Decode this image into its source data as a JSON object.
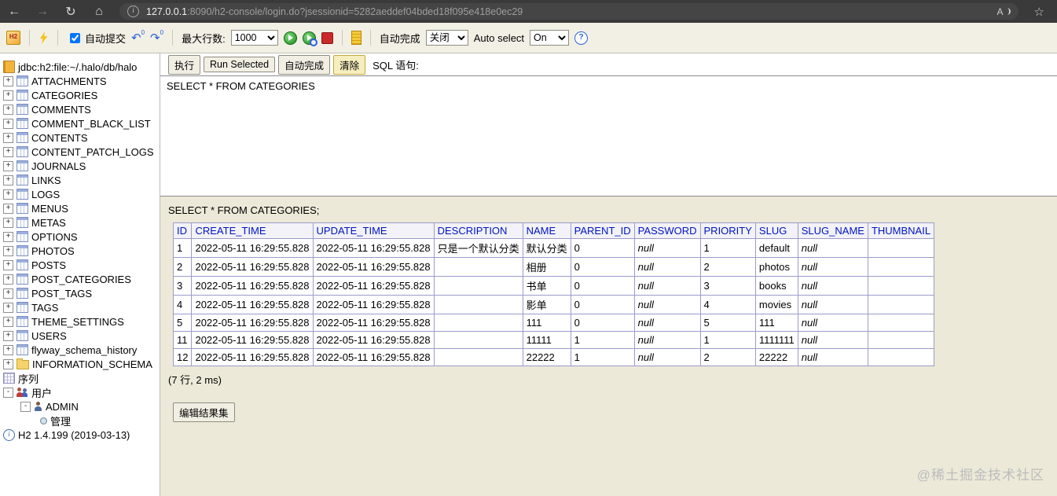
{
  "browser": {
    "url_host": "127.0.0.1",
    "url_rest": ":8090/h2-console/login.do?jsessionid=5282aeddef04bded18f095e418e0ec29"
  },
  "icons": {
    "back": "←",
    "forward": "→",
    "refresh": "↻",
    "home": "⌂",
    "info": "i",
    "read_aloud": "A",
    "favorites_star": "☆",
    "undo": "↶",
    "redo": "↷",
    "help": "?",
    "h2_logo": "H2",
    "expand_plus": "+",
    "expand_minus": "-"
  },
  "toolbar": {
    "autocommit_label": "自动提交",
    "undo_count": "0",
    "redo_count": "0",
    "max_rows_label": "最大行数:",
    "max_rows_value": "1000",
    "autocomplete_label": "自动完成",
    "autocomplete_value": "关闭",
    "autoselect_label": "Auto select",
    "autoselect_value": "On"
  },
  "sidebar": {
    "root": "jdbc:h2:file:~/.halo/db/halo",
    "tables": [
      "ATTACHMENTS",
      "CATEGORIES",
      "COMMENTS",
      "COMMENT_BLACK_LIST",
      "CONTENTS",
      "CONTENT_PATCH_LOGS",
      "JOURNALS",
      "LINKS",
      "LOGS",
      "MENUS",
      "METAS",
      "OPTIONS",
      "PHOTOS",
      "POSTS",
      "POST_CATEGORIES",
      "POST_TAGS",
      "TAGS",
      "THEME_SETTINGS",
      "USERS",
      "flyway_schema_history"
    ],
    "info_schema": "INFORMATION_SCHEMA",
    "sequences": "序列",
    "users_node": "用户",
    "admin_node": "ADMIN",
    "admin_child": "管理",
    "version": "H2 1.4.199 (2019-03-13)"
  },
  "query": {
    "run_label": "执行",
    "run_selected_label": "Run Selected",
    "autocomplete_label": "自动完成",
    "clear_label": "清除",
    "sql_label": "SQL 语句:",
    "sql_text": "SELECT * FROM CATEGORIES"
  },
  "results": {
    "statement": "SELECT * FROM CATEGORIES;",
    "columns": [
      "ID",
      "CREATE_TIME",
      "UPDATE_TIME",
      "DESCRIPTION",
      "NAME",
      "PARENT_ID",
      "PASSWORD",
      "PRIORITY",
      "SLUG",
      "SLUG_NAME",
      "THUMBNAIL"
    ],
    "rows": [
      [
        "1",
        "2022-05-11 16:29:55.828",
        "2022-05-11 16:29:55.828",
        "只是一个默认分类",
        "默认分类",
        "0",
        "null",
        "1",
        "default",
        "null",
        ""
      ],
      [
        "2",
        "2022-05-11 16:29:55.828",
        "2022-05-11 16:29:55.828",
        "",
        "相册",
        "0",
        "null",
        "2",
        "photos",
        "null",
        ""
      ],
      [
        "3",
        "2022-05-11 16:29:55.828",
        "2022-05-11 16:29:55.828",
        "",
        "书单",
        "0",
        "null",
        "3",
        "books",
        "null",
        ""
      ],
      [
        "4",
        "2022-05-11 16:29:55.828",
        "2022-05-11 16:29:55.828",
        "",
        "影单",
        "0",
        "null",
        "4",
        "movies",
        "null",
        ""
      ],
      [
        "5",
        "2022-05-11 16:29:55.828",
        "2022-05-11 16:29:55.828",
        "",
        "111",
        "0",
        "null",
        "5",
        "111",
        "null",
        ""
      ],
      [
        "11",
        "2022-05-11 16:29:55.828",
        "2022-05-11 16:29:55.828",
        "",
        "11111",
        "1",
        "null",
        "1",
        "1111111",
        "null",
        ""
      ],
      [
        "12",
        "2022-05-11 16:29:55.828",
        "2022-05-11 16:29:55.828",
        "",
        "22222",
        "1",
        "null",
        "2",
        "22222",
        "null",
        ""
      ]
    ],
    "summary": "(7 行, 2 ms)",
    "edit_button": "编辑结果集"
  },
  "watermark": "@稀土掘金技术社区"
}
